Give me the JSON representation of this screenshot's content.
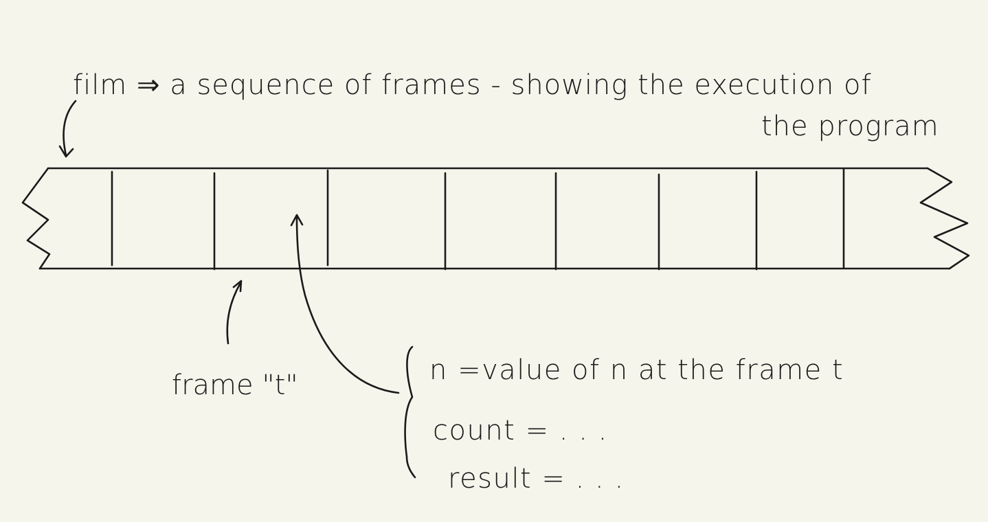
{
  "colors": {
    "background": "#f5f5ec",
    "ink": "#1a1a1a"
  },
  "annotations": {
    "film_title_line1": "film ⇒ a sequence of frames - showing the execution of",
    "film_title_line2": "the program",
    "frame_label": "frame \"t\"",
    "n_line": "n =value of n at the frame t",
    "count_line": "count = . . .",
    "result_line": "result = . . ."
  }
}
